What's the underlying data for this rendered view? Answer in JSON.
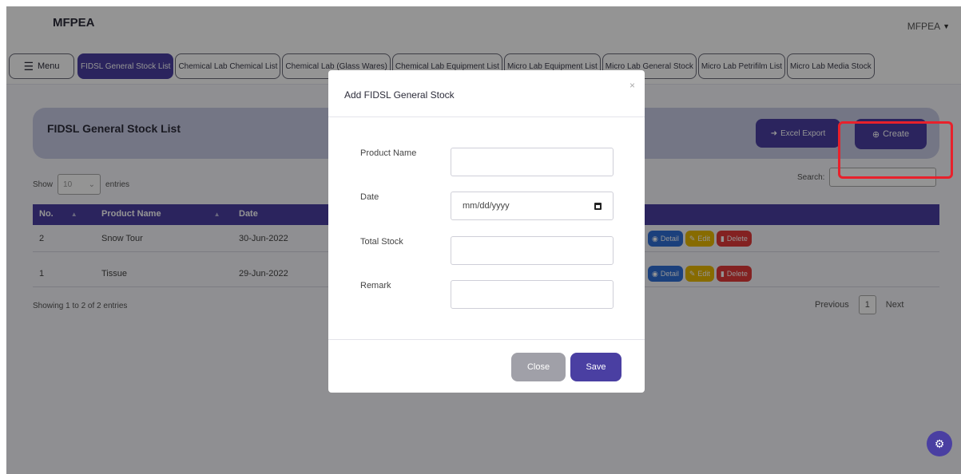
{
  "header": {
    "brand": "MFPEA",
    "user": "MFPEA"
  },
  "menu_label": "Menu",
  "tabs": [
    {
      "label": "FIDSL General Stock List",
      "active": true
    },
    {
      "label": "Chemical Lab Chemical List"
    },
    {
      "label": "Chemical Lab (Glass Wares)"
    },
    {
      "label": "Chemical Lab Equipment List"
    },
    {
      "label": "Micro Lab Equipment List"
    },
    {
      "label": "Micro Lab General Stock"
    },
    {
      "label": "Micro Lab Petrifilm List"
    },
    {
      "label": "Micro Lab Media Stock"
    }
  ],
  "page": {
    "title": "FIDSL General Stock List",
    "excel_label": "Excel Export",
    "create_label": "Create"
  },
  "table": {
    "show_label": "Show",
    "page_length": "10",
    "entries_label": "entries",
    "search_label": "Search:",
    "columns": [
      "No.",
      "Product Name",
      "Date"
    ],
    "rows": [
      {
        "no": "2",
        "name": "Snow Tour",
        "date": "30-Jun-2022"
      },
      {
        "no": "1",
        "name": "Tissue",
        "date": "29-Jun-2022"
      }
    ],
    "actions": {
      "detail": "Detail",
      "edit": "Edit",
      "delete": "Delete"
    },
    "info": "Showing 1 to 2 of 2 entries",
    "pager": {
      "previous": "Previous",
      "page": "1",
      "next": "Next"
    }
  },
  "modal": {
    "title": "Add FIDSL General Stock",
    "close_glyph": "×",
    "fields": [
      {
        "label": "Product Name",
        "value": ""
      },
      {
        "label": "Date",
        "value": "mm/dd/yyyy"
      },
      {
        "label": "Total Stock",
        "value": ""
      },
      {
        "label": "Remark",
        "value": ""
      }
    ],
    "close_label": "Close",
    "save_label": "Save"
  },
  "colors": {
    "primary": "#4a3fa2",
    "highlight": "#e8212b"
  }
}
